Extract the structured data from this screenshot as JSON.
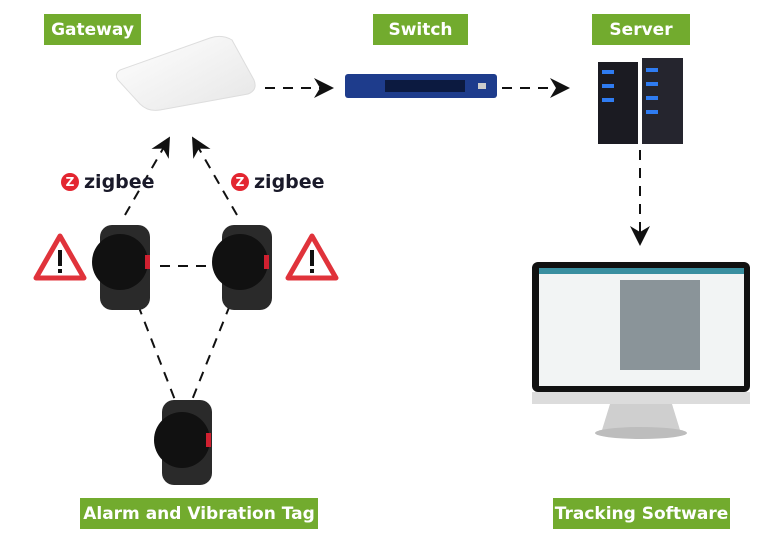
{
  "labels": {
    "gateway": "Gateway",
    "switch": "Switch",
    "server": "Server",
    "tag": "Alarm and Vibration Tag",
    "software": "Tracking Software"
  },
  "protocol": {
    "name": "zigbee"
  },
  "colors": {
    "label_bg": "#72ab2e",
    "zigbee_red": "#e32630",
    "warning_red": "#e0333b",
    "switch_blue": "#1e3c8c"
  }
}
